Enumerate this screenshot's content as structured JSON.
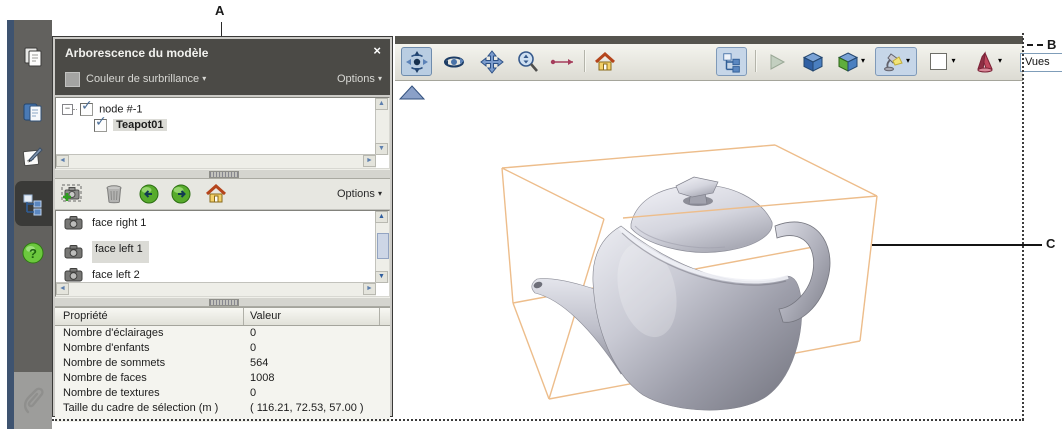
{
  "callouts": {
    "a": "A",
    "b": "B",
    "c": "C"
  },
  "icons": {
    "caret_down": "▾",
    "check": "✓",
    "collapse_minus": "−",
    "scroll_left": "◄",
    "scroll_right": "►",
    "scroll_up": "▲",
    "scroll_down": "▼"
  },
  "panel": {
    "title": "Arborescence du modèle",
    "close_label": "×",
    "highlight_label": "Couleur de surbrillance",
    "options_label": "Options",
    "tree": [
      {
        "label": "node #-1"
      },
      {
        "label": "Teapot01"
      }
    ],
    "views": {
      "options_label": "Options",
      "items": [
        {
          "label": "face right 1"
        },
        {
          "label": "face left 1"
        },
        {
          "label": "face left 2"
        }
      ],
      "selected_index": 1
    },
    "properties": {
      "columns": [
        "Propriété",
        "Valeur"
      ],
      "rows": [
        [
          "Nombre d'éclairages",
          "0"
        ],
        [
          "Nombre d'enfants",
          "0"
        ],
        [
          "Nombre de sommets",
          "564"
        ],
        [
          "Nombre de faces",
          "1008"
        ],
        [
          "Nombre de textures",
          "0"
        ],
        [
          "Taille du cadre de sélection (m )",
          "( 116.21, 72.53, 57.00 )"
        ]
      ]
    }
  },
  "toolbar": {
    "views_dropdown_value": "Vues",
    "buttons": [
      "rotate",
      "spin",
      "pan",
      "zoom",
      "measure",
      "default-view",
      "toggle-model-tree",
      "play",
      "render-solid",
      "render-mode",
      "lighting",
      "background-color",
      "cross-section"
    ]
  },
  "sidebar": {
    "items": [
      "pages",
      "layers",
      "signatures",
      "model-tree",
      "help"
    ],
    "active_item": "model-tree",
    "attachment": "paperclip"
  },
  "scene": {
    "model_name": "Teapot01",
    "bounding_box_color": "#edbd8b",
    "teapot_color": "#c7c8d2",
    "background": "#ffffff"
  },
  "colors": {
    "panel_header": "#4b4a46",
    "sidebar": "#62615e",
    "sidebar_strip": "#3e5370",
    "selection": "#dbdbd6",
    "toolbar_pressed": "#c6d6e8"
  }
}
